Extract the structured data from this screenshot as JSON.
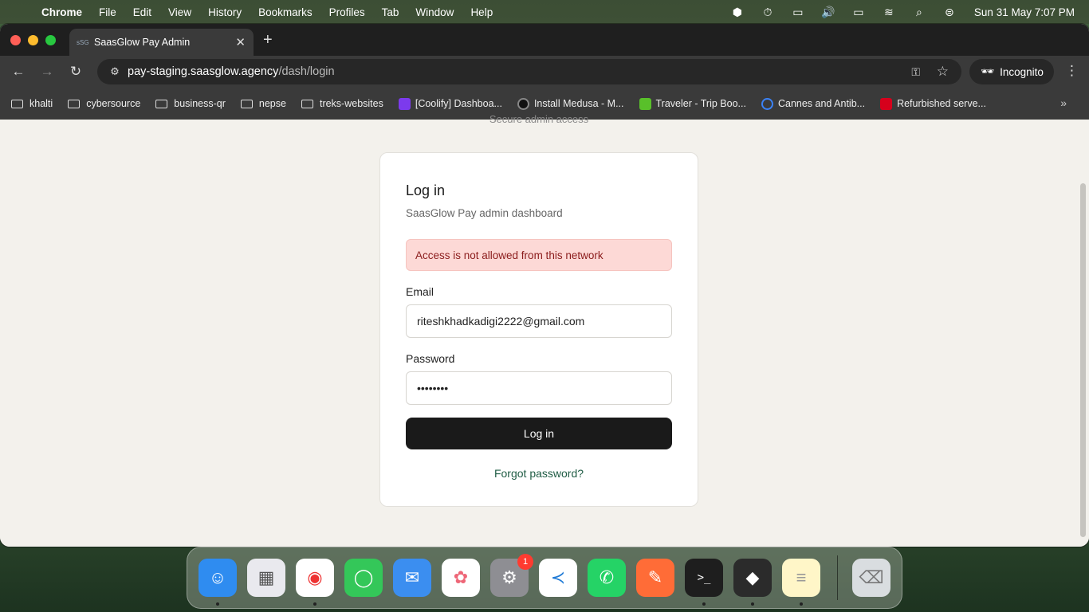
{
  "menubar": {
    "app_name": "Chrome",
    "items": [
      "File",
      "Edit",
      "View",
      "History",
      "Bookmarks",
      "Profiles",
      "Tab",
      "Window",
      "Help"
    ],
    "status_icons": [
      "box-icon",
      "timer-icon",
      "battery-card-icon",
      "volume-icon",
      "display-icon",
      "wifi-icon",
      "search-icon",
      "control-center-icon"
    ],
    "clock": "Sun 31 May  7:07 PM"
  },
  "browser": {
    "tab_title": "SaasGlow Pay Admin",
    "tab_favicon": "sSG",
    "url_host": "pay-staging.saasglow.agency",
    "url_path": "/dash/login",
    "incognito_label": "Incognito",
    "bookmarks": [
      {
        "label": "khalti",
        "icon": "folder-icon"
      },
      {
        "label": "cybersource",
        "icon": "folder-icon"
      },
      {
        "label": "business-qr",
        "icon": "folder-icon"
      },
      {
        "label": "nepse",
        "icon": "folder-icon"
      },
      {
        "label": "treks-websites",
        "icon": "folder-icon"
      },
      {
        "label": "[Coolify] Dashboa...",
        "icon": "coolify-icon",
        "color": "#7c3aed"
      },
      {
        "label": "Install Medusa - M...",
        "icon": "medusa-icon",
        "color": "#222222"
      },
      {
        "label": "Traveler - Trip Boo...",
        "icon": "traveler-icon",
        "color": "#59c02a"
      },
      {
        "label": "Cannes and Antib...",
        "icon": "t-icon",
        "color": "#3b82f6"
      },
      {
        "label": "Refurbished serve...",
        "icon": "h-icon",
        "color": "#d6001c"
      }
    ]
  },
  "page": {
    "secure_text": "Secure admin access",
    "card": {
      "title": "Log in",
      "subtitle": "SaasGlow Pay admin dashboard",
      "alert": "Access is not allowed from this network",
      "email_label": "Email",
      "email_value": "riteshkhadkadigi2222@gmail.com",
      "password_label": "Password",
      "password_value": "••••••••",
      "login_button": "Log in",
      "forgot_link": "Forgot password?"
    }
  },
  "dock": {
    "apps": [
      {
        "name": "finder-icon",
        "color": "#2f8cf0",
        "glyph": "☺",
        "running": true
      },
      {
        "name": "launchpad-icon",
        "color": "#e9e9ee",
        "glyph": "▦",
        "running": false
      },
      {
        "name": "chrome-icon",
        "color": "#ffffff",
        "glyph": "◉",
        "running": true
      },
      {
        "name": "messages-icon",
        "color": "#34c759",
        "glyph": "💬",
        "running": false
      },
      {
        "name": "mail-icon",
        "color": "#3b8ef0",
        "glyph": "✉",
        "running": false
      },
      {
        "name": "photos-icon",
        "color": "#ffffff",
        "glyph": "✿",
        "running": false
      },
      {
        "name": "system-settings-icon",
        "color": "#8e8e93",
        "glyph": "⚙",
        "running": false,
        "badge": "1"
      },
      {
        "name": "vscode-icon",
        "color": "#ffffff",
        "glyph": "≺",
        "running": false
      },
      {
        "name": "whatsapp-icon",
        "color": "#25d366",
        "glyph": "✆",
        "running": false
      },
      {
        "name": "postman-icon",
        "color": "#ff6c37",
        "glyph": "✎",
        "running": false
      },
      {
        "name": "terminal-icon",
        "color": "#1e1e1e",
        "glyph": ">_",
        "running": true
      },
      {
        "name": "box-app-icon",
        "color": "#2b2b2b",
        "glyph": "◆",
        "running": true
      },
      {
        "name": "notes-icon",
        "color": "#fff6c8",
        "glyph": "≡",
        "running": true
      }
    ],
    "trash": {
      "name": "trash-icon",
      "color": "#d9dde0",
      "glyph": "🗑"
    }
  }
}
